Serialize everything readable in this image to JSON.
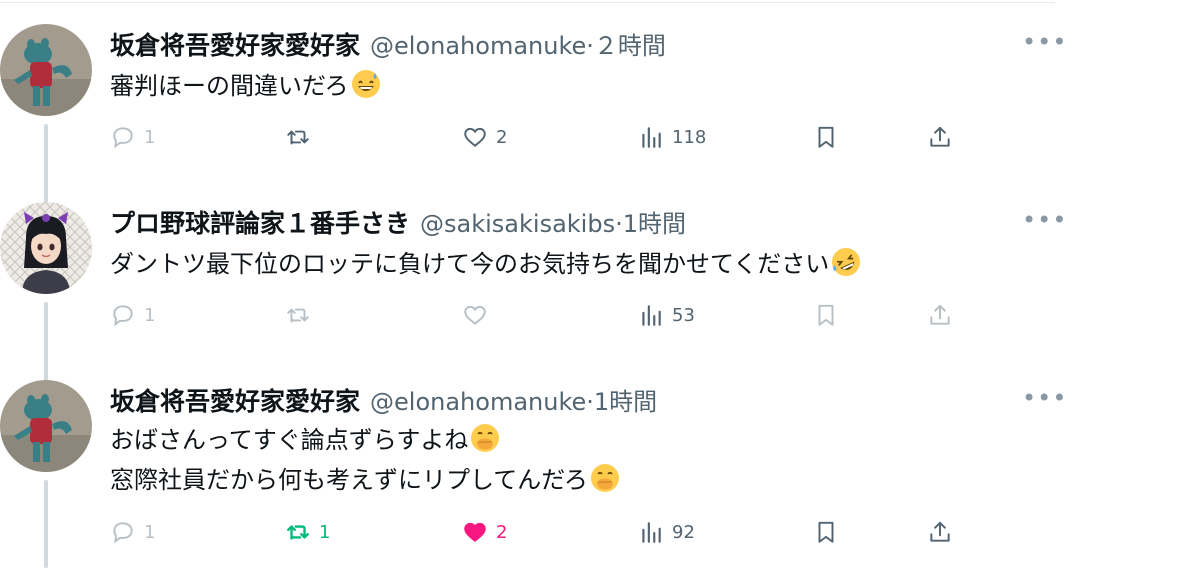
{
  "tweets": [
    {
      "name": "坂倉将吾愛好家愛好家",
      "handle": "@elonahomanuke",
      "time": "·２時間",
      "lines": [
        "審判ほーの間違いだろ"
      ],
      "emoji": "grinning-sweat-emoji",
      "reply_count": "1",
      "retweet_count": "",
      "like_count": "2",
      "view_count": "118",
      "liked": false,
      "retweeted": false
    },
    {
      "name": "プロ野球評論家１番手さき",
      "handle": "@sakisakisakibs",
      "time": "·1時間",
      "lines": [
        "ダントツ最下位のロッテに負けて今のお気持ちを聞かせてください"
      ],
      "emoji": "rofl-emoji",
      "reply_count": "1",
      "retweet_count": "",
      "like_count": "",
      "view_count": "53",
      "liked": false,
      "retweeted": false
    },
    {
      "name": "坂倉将吾愛好家愛好家",
      "handle": "@elonahomanuke",
      "time": "·1時間",
      "lines": [
        "おばさんってすぐ論点ずらすよね",
        "窓際社員だから何も考えずにリプしてんだろ"
      ],
      "emoji": "hand-over-mouth-emoji",
      "reply_count": "1",
      "retweet_count": "1",
      "like_count": "2",
      "view_count": "92",
      "liked": true,
      "retweeted": true
    }
  ],
  "colors": {
    "text": "#0f1419",
    "secondary": "#536471",
    "like_active": "#f91880",
    "retweet_active": "#00ba7c",
    "thread_line": "#cfd9de"
  },
  "icons": [
    "reply-icon",
    "retweet-icon",
    "like-icon",
    "views-icon",
    "bookmark-icon",
    "share-icon",
    "more-icon"
  ]
}
